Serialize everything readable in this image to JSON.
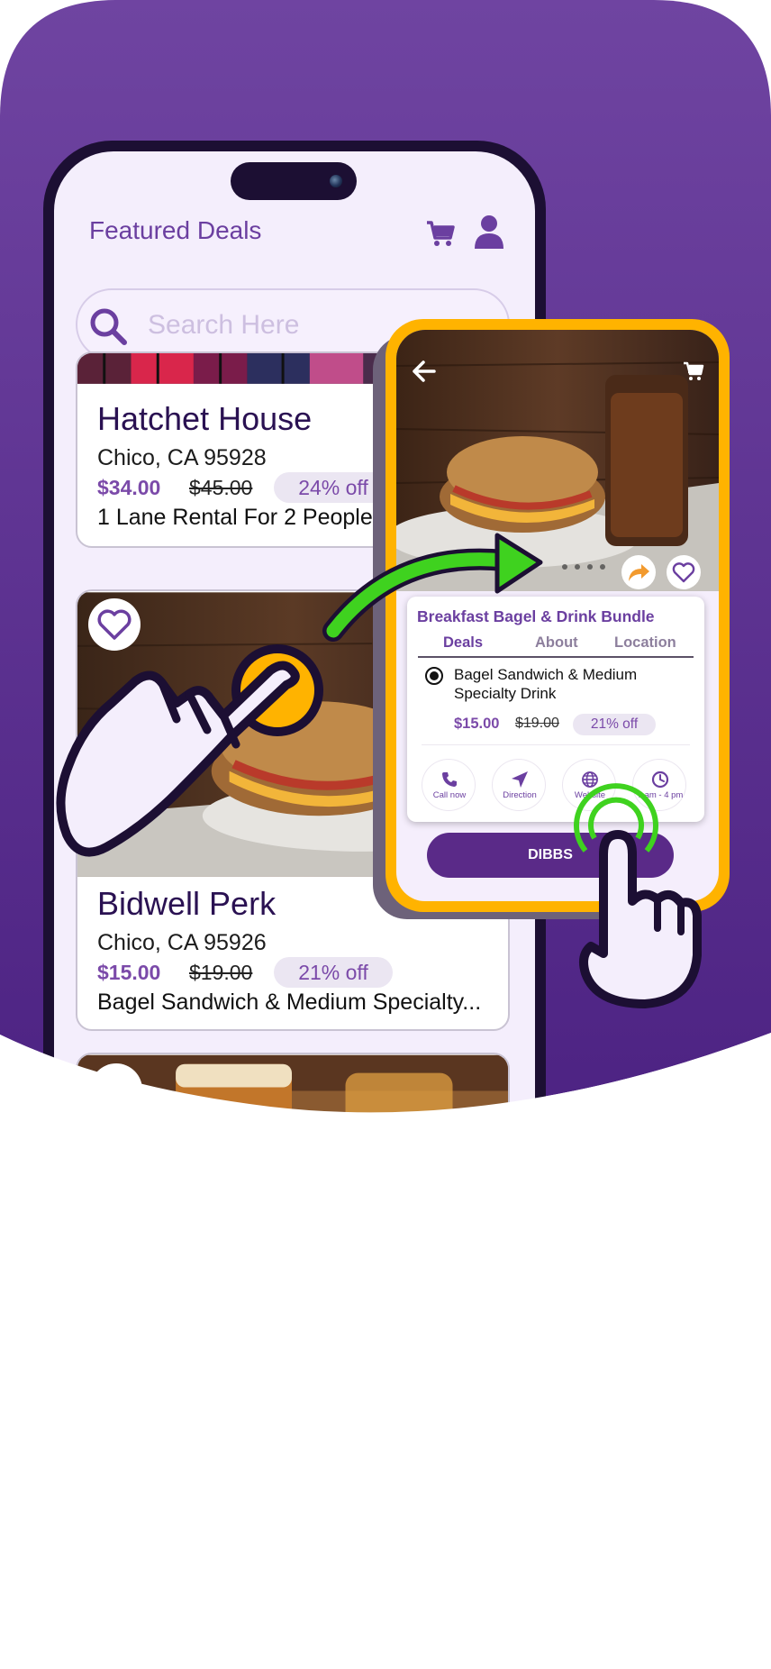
{
  "colors": {
    "brand_purple": "#6b3fa0",
    "hero_gradient_top": "#6f44a1",
    "hero_gradient_bottom": "#4d2383",
    "highlight_orange": "#ffb300",
    "gesture_green": "#3fd21f",
    "button_purple": "#5a2a88"
  },
  "app": {
    "title": "Featured Deals",
    "cart_icon": "cart-icon",
    "account_icon": "user-icon"
  },
  "search": {
    "placeholder": "Search Here",
    "icon": "search-icon"
  },
  "deals": [
    {
      "name": "Hatchet House",
      "location": "Chico, CA 95928",
      "price": "$34.00",
      "original_price": "$45.00",
      "discount": "24% off",
      "description": "1 Lane Rental For 2 People"
    },
    {
      "name": "Bidwell Perk",
      "location": "Chico, CA 95926",
      "price": "$15.00",
      "original_price": "$19.00",
      "discount": "21% off",
      "description": "Bagel Sandwich & Medium Specialty..."
    }
  ],
  "detail": {
    "title": "Breakfast Bagel & Drink Bundle",
    "tabs": [
      "Deals",
      "About",
      "Location"
    ],
    "active_tab": "Deals",
    "deal_name": "Bagel Sandwich & Medium Specialty Drink",
    "price": "$15.00",
    "original_price": "$19.00",
    "discount": "21% off",
    "actions": [
      {
        "label": "Call now",
        "icon": "phone-icon"
      },
      {
        "label": "Direction",
        "icon": "navigation-arrow-icon"
      },
      {
        "label": "Website",
        "icon": "globe-icon"
      },
      {
        "label": "7 am - 4 pm",
        "icon": "clock-icon"
      }
    ],
    "cta": "DIBBS",
    "icons": [
      "back-arrow-icon",
      "cart-icon",
      "share-icon",
      "heart-icon"
    ]
  },
  "gestures": [
    "tap-hand-icon",
    "tap-hand-icon",
    "curved-arrow-icon"
  ]
}
